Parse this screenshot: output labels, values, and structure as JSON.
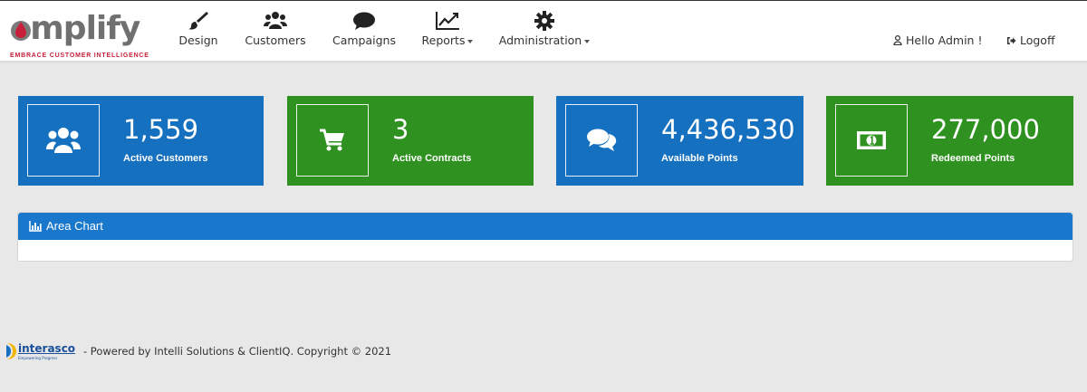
{
  "brand": {
    "name": "amplify",
    "tagline": "EMBRACE CUSTOMER INTELLIGENCE",
    "accent": "#c81f3a"
  },
  "nav": {
    "items": [
      {
        "label": "Design",
        "icon": "paintbrush-icon"
      },
      {
        "label": "Customers",
        "icon": "users-icon"
      },
      {
        "label": "Campaigns",
        "icon": "comment-icon"
      },
      {
        "label": "Reports",
        "icon": "line-chart-icon",
        "dropdown": true
      },
      {
        "label": "Administration",
        "icon": "gear-icon",
        "dropdown": true
      }
    ],
    "user": "Hello Admin !",
    "logoff": "Logoff"
  },
  "tiles": [
    {
      "value": "1,559",
      "label": "Active Customers",
      "icon": "users-icon",
      "color": "#1570bf"
    },
    {
      "value": "3",
      "label": "Active Contracts",
      "icon": "cart-icon",
      "color": "#2f9220"
    },
    {
      "value": "4,436,530",
      "label": "Available Points",
      "icon": "comments-icon",
      "color": "#1570bf"
    },
    {
      "value": "277,000",
      "label": "Redeemed Points",
      "icon": "money-icon",
      "color": "#2f9220"
    }
  ],
  "panel": {
    "title": "Area Chart",
    "header_color": "#1a78cc"
  },
  "footer": {
    "logo_text": "interasco",
    "logo_subtext": "Empowering Progress",
    "text": "- Powered by Intelli Solutions & ClientIQ. Copyright © 2021"
  }
}
